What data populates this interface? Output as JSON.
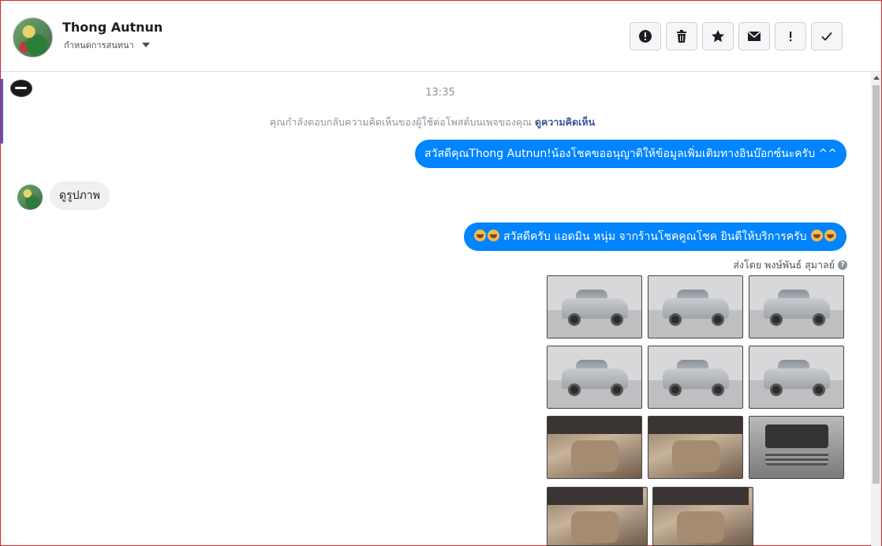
{
  "header": {
    "contact_name": "Thong Autnun",
    "assign_label": "กำหนดการสนทนา",
    "tools": [
      {
        "name": "spam-button",
        "icon": "alert-circle-icon"
      },
      {
        "name": "delete-button",
        "icon": "trash-icon"
      },
      {
        "name": "star-button",
        "icon": "star-icon"
      },
      {
        "name": "mark-unread-button",
        "icon": "envelope-icon"
      },
      {
        "name": "important-button",
        "icon": "exclamation-icon"
      },
      {
        "name": "mark-done-button",
        "icon": "check-icon"
      }
    ]
  },
  "thread": {
    "time": "13:35",
    "notice": "คุณกำลังตอบกลับความคิดเห็นของผู้ใช้ต่อโพสต์บนเพจของคุณ",
    "notice_link": "ดูความคิดเห็น",
    "msg_out_1": "สวัสดีคุณThong Autnun!น้องโชคขออนุญาติให้ข้อมูลเพิ่มเติมทางอินบ๊อกซ์นะครับ ^^",
    "msg_in_1": "ดูรูปภาพ",
    "msg_out_2": "สวัสดีครับ แอดมิน หนุ่ม จากร้านโชคคูณโชค ยินดีให้บริการครับ",
    "sent_by": "ส่งโดย พงษ์พันธ์ สุมาลย์",
    "photos": [
      "exterior",
      "exterior",
      "exterior",
      "exterior",
      "exterior",
      "exterior",
      "interior",
      "interior",
      "engine",
      "interior",
      "interior"
    ]
  }
}
